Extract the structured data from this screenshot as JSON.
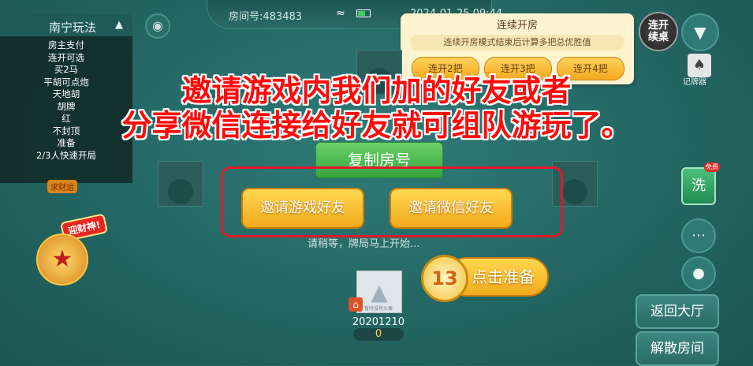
{
  "header": {
    "room_number": "房间号:483483",
    "time": "2024-01-25 09:44",
    "wifi_icon": "wifi-icon",
    "battery_icon": "battery-icon"
  },
  "rules": {
    "title": "南宁玩法",
    "items": [
      "房主支付",
      "连开可选",
      "买2马",
      "平胡可点炮",
      "天地胡",
      "胡牌",
      "红",
      "",
      "不封顶",
      "准备",
      "2/3人快速开局"
    ]
  },
  "continue_room": {
    "title": "连续开房",
    "description": "连续开房模式结束后计算多把总优胜值",
    "options": [
      "连开2把",
      "连开3把",
      "连开4把"
    ],
    "button_label": "连开续桌"
  },
  "tracker_label": "记牌器",
  "overlay": {
    "line1": "邀请游戏内我们加的好友或者",
    "line2": "分享微信连接给好友就可组队游玩了。"
  },
  "copy_room_label": "复制房号",
  "invite": {
    "game_friend_label": "邀请游戏好友",
    "wechat_friend_label": "邀请微信好友"
  },
  "wait_text": "请稍等，牌局马上开始...",
  "ready": {
    "countdown": "13",
    "label": "点击准备"
  },
  "player": {
    "avatar_caption": "暂时没有头像",
    "name": "20201210",
    "score": "0"
  },
  "side": {
    "shuffle_label": "洗",
    "shuffle_badge": "免费",
    "back_label": "返回大厅",
    "dissolve_label": "解散房间"
  },
  "wealth": {
    "tag": "迎财神!",
    "small_tag": "求财运"
  }
}
